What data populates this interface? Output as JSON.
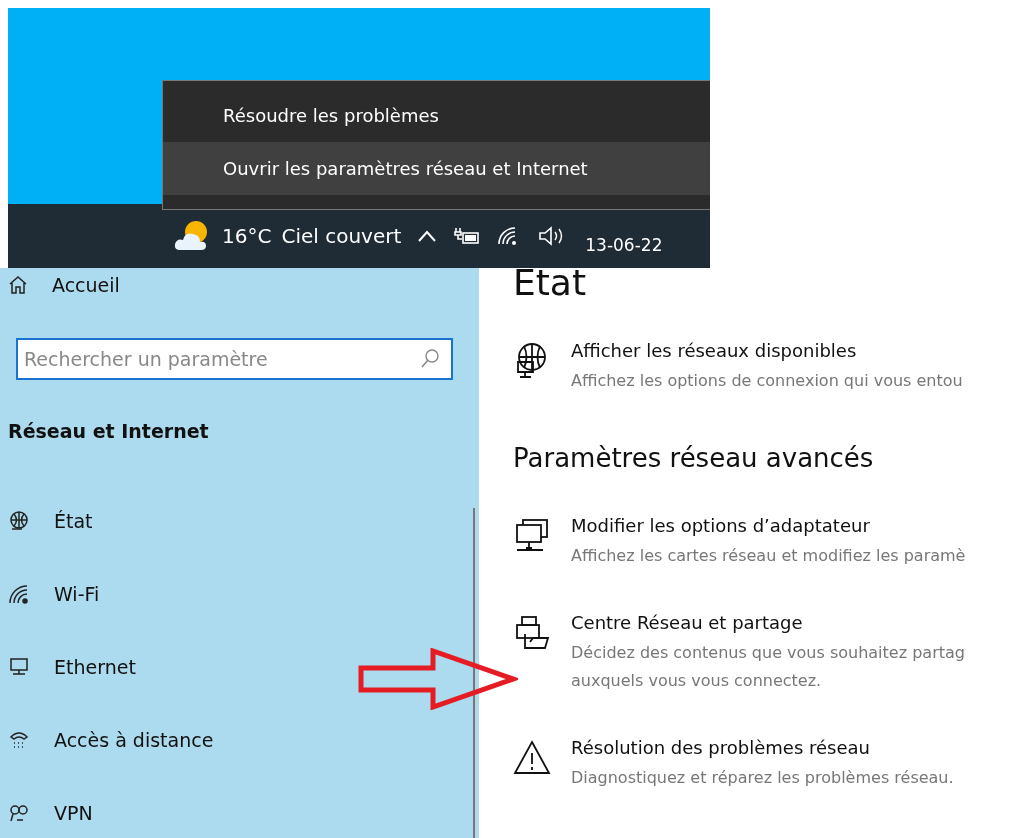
{
  "desktop": {
    "context_menu": [
      {
        "label": "Résoudre les problèmes",
        "selected": false
      },
      {
        "label": "Ouvrir les paramètres réseau et Internet",
        "selected": true
      }
    ],
    "taskbar": {
      "temperature": "16°C",
      "weather": "Ciel couvert",
      "date": "13-06-22"
    }
  },
  "sidebar": {
    "home": "Accueil",
    "search": {
      "placeholder": "Rechercher un paramètre"
    },
    "section_title": "Réseau et Internet",
    "items": [
      {
        "label": "État",
        "kind": "status"
      },
      {
        "label": "Wi-Fi",
        "kind": "wifi"
      },
      {
        "label": "Ethernet",
        "kind": "ethernet"
      },
      {
        "label": "Accès à distance",
        "kind": "dialup"
      },
      {
        "label": "VPN",
        "kind": "vpn"
      }
    ]
  },
  "content": {
    "title": "Etat",
    "top_items": [
      {
        "title": "Afficher les réseaux disponibles",
        "description": [
          "Affichez les options de connexion qui vous entou"
        ],
        "kind": "globe"
      }
    ],
    "section_heading": "Paramètres réseau avancés",
    "items": [
      {
        "title": "Modifier les options d’adaptateur",
        "description": [
          "Affichez les cartes réseau et modifiez les paramè"
        ],
        "kind": "adapter"
      },
      {
        "title": "Centre Réseau et partage",
        "description": [
          "Décidez des contenus que vous souhaitez partag",
          "auxquels vous vous connectez."
        ],
        "kind": "sharing"
      },
      {
        "title": "Résolution des problèmes réseau",
        "description": [
          "Diagnostiquez et réparez les problèmes réseau."
        ],
        "kind": "troubleshoot"
      }
    ]
  }
}
